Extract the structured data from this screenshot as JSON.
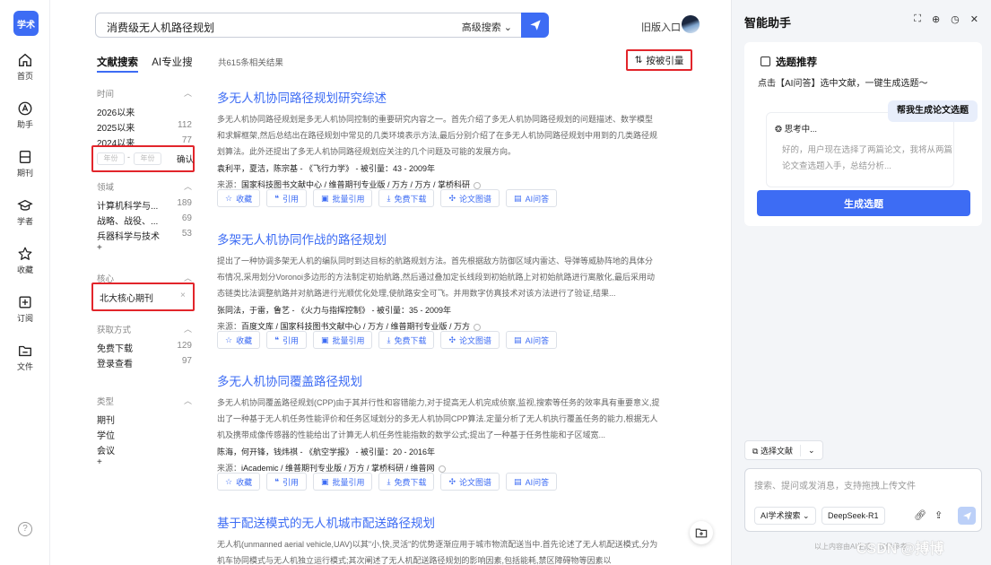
{
  "app": {
    "logo": "学术"
  },
  "rail": [
    {
      "label": "首页",
      "icon": "home-icon"
    },
    {
      "label": "助手",
      "icon": "ai-icon"
    },
    {
      "label": "期刊",
      "icon": "journal-icon"
    },
    {
      "label": "学者",
      "icon": "scholar-icon"
    },
    {
      "label": "收藏",
      "icon": "star-icon"
    },
    {
      "label": "订阅",
      "icon": "subscribe-icon"
    },
    {
      "label": "文件",
      "icon": "folder-icon"
    }
  ],
  "search": {
    "query": "消费级无人机路径规划",
    "advanced": "高级搜索"
  },
  "header": {
    "old_entry": "旧版入口"
  },
  "tabs": {
    "literature": "文献搜索",
    "ai": "AI专业搜"
  },
  "filters": {
    "time": {
      "title": "时间",
      "items": [
        {
          "label": "2026以来",
          "count": ""
        },
        {
          "label": "2025以来",
          "count": "112"
        },
        {
          "label": "2024以来",
          "count": "77"
        }
      ],
      "year_placeholder": "年份",
      "range_sep": "-",
      "confirm": "确认"
    },
    "field": {
      "title": "领域",
      "items": [
        {
          "label": "计算机科学与...",
          "count": "189"
        },
        {
          "label": "战略、战役、...",
          "count": "69"
        },
        {
          "label": "兵器科学与技术",
          "count": "53"
        }
      ],
      "more": "+"
    },
    "core": {
      "title": "核心",
      "selected": "北大核心期刊",
      "remove": "×"
    },
    "access": {
      "title": "获取方式",
      "items": [
        {
          "label": "免费下载",
          "count": "129"
        },
        {
          "label": "登录查看",
          "count": "97"
        }
      ]
    },
    "type": {
      "title": "类型",
      "items": [
        {
          "label": "期刊"
        },
        {
          "label": "学位"
        },
        {
          "label": "会议"
        }
      ],
      "more": "+"
    }
  },
  "results": {
    "count": "共615条相关结果",
    "sort": "按被引量",
    "source_label": "来源：",
    "actions": [
      "收藏",
      "引用",
      "批量引用",
      "免费下载",
      "论文图谱",
      "AI问答"
    ],
    "items": [
      {
        "title": "多无人机协同路径规划研究综述",
        "abstract": "多无人机协同路径规划是多无人机协同控制的重要研究内容之一。首先介绍了多无人机协同路径规划的问题描述、数学模型和求解框架,然后总结出在路径规划中常见的几类环境表示方法,最后分别介绍了在多无人机协同路径规划中用到的几类路径规划算法。此外还提出了多无人机协同路径规划应关注的几个问题及可能的发展方向。",
        "meta": "袁利平，夏洁，陈宗基 - 《飞行力学》 - 被引量：43 - 2009年",
        "source": "国家科技图书文献中心 / 维普期刊专业版 / 万方 / 万方 / 掌桥科研"
      },
      {
        "title": "多架无人机协同作战的路径规划",
        "abstract": "提出了一种协调多架无人机的编队同时到达目标的航路规划方法。首先根据敌方防御区域内雷达、导弹等威胁阵地的具体分布情况,采用划分Voronoi多边形的方法制定初始航路,然后通过叠加定长线段到初始航路上对初始航路进行离散化,最后采用动态链类比法调整航路并对航路进行光顺优化处理,使航路安全可飞。并用数字仿真技术对该方法进行了验证,结果...",
        "meta": "张同法，于雷，鲁艺 - 《火力与指挥控制》 - 被引量：35 - 2009年",
        "source": "百度文库 / 国家科技图书文献中心 / 万方 / 维普期刊专业版 / 万方"
      },
      {
        "title": "多无人机协同覆盖路径规划",
        "abstract": "多无人机协同覆盖路径规划(CPP)由于其并行性和容错能力,对于提高无人机完成侦察,监视,搜索等任务的效率具有重要意义,提出了一种基于无人机任务性能评价和任务区域划分的多无人机协同CPP算法.定量分析了无人机执行覆盖任务的能力,根据无人机及携带成像传感器的性能给出了计算无人机任务性能指数的数学公式;提出了一种基于任务性能和子区域宽...",
        "meta": "陈海，何开锋，钱炜祺 - 《航空学报》 - 被引量：20 - 2016年",
        "source": "iAcademic / 维普期刊专业版 / 万方 / 掌桥科研 / 维普网"
      },
      {
        "title": "基于配送模式的无人机城市配送路径规划",
        "abstract": "无人机(unmanned aerial vehicle,UAV)以其\"小,快,灵活\"的优势逐渐应用于城市物流配送当中.首先论述了无人机配送模式,分为机车协同模式与无人机独立运行模式;其次阐述了无人机配送路径规划的影响因素,包括能耗,禁区障碍物等因素以",
        "meta": "",
        "source": ""
      }
    ]
  },
  "assistant": {
    "title": "智能助手",
    "card_title": "选题推荐",
    "card_sub": "点击【AI问答】选中文献，一键生成选题～",
    "bubble": "帮我生成论文选题",
    "thinking": "思考中...",
    "thinking_text": "好的，用户现在选择了两篇论文，我将从两篇论文查选题入手，总结分析...",
    "generate": "生成选题",
    "choose": "选择文献",
    "input_placeholder": "搜索、提问或发消息，支持拖拽上传文件",
    "chip_search": "AI学术搜索",
    "chip_model": "DeepSeek-R1",
    "footer": "以上内容由AI生成，仅供参考",
    "watermark": "CSDN @搏博"
  },
  "colors": {
    "accent": "#3d6cf4",
    "highlight": "#e2252b"
  }
}
